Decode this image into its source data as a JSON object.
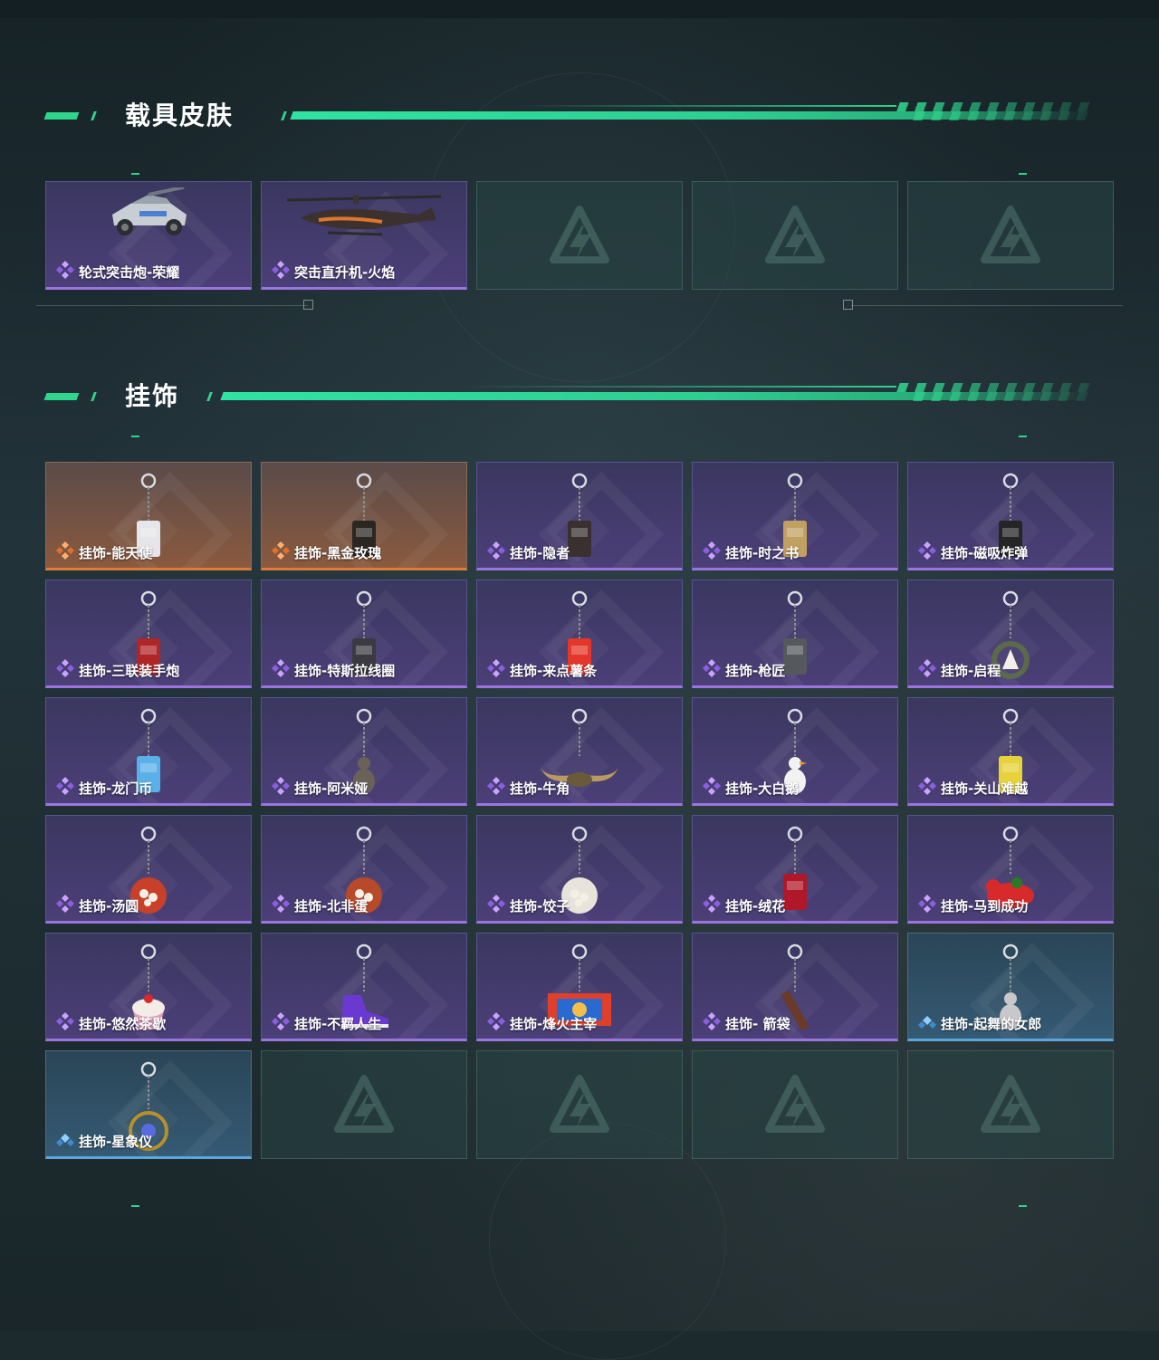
{
  "colors": {
    "accent": "#2fd48d",
    "purple_rarity": "#9b74e0",
    "orange_rarity": "#e07a38",
    "blue_rarity": "#5aa6dd"
  },
  "sections": [
    {
      "title": "载具皮肤",
      "items": [
        {
          "label": "轮式突击炮-荣耀",
          "rarity": "purple",
          "icon": "armored-car-icon"
        },
        {
          "label": "突击直升机-火焰",
          "rarity": "purple",
          "icon": "helicopter-icon"
        },
        {
          "label": "",
          "rarity": "empty"
        },
        {
          "label": "",
          "rarity": "empty"
        },
        {
          "label": "",
          "rarity": "empty"
        }
      ]
    },
    {
      "title": "挂饰",
      "items": [
        {
          "label": "挂饰-能天使",
          "rarity": "orange",
          "icon": "charm-card-icon"
        },
        {
          "label": "挂饰-黑金玫瑰",
          "rarity": "orange",
          "icon": "charm-rose-icon"
        },
        {
          "label": "挂饰-隐者",
          "rarity": "purple",
          "icon": "charm-tarot-icon"
        },
        {
          "label": "挂饰-时之书",
          "rarity": "purple",
          "icon": "charm-book-icon"
        },
        {
          "label": "挂饰-磁吸炸弹",
          "rarity": "purple",
          "icon": "charm-bomb-icon"
        },
        {
          "label": "挂饰-三联装手炮",
          "rarity": "purple",
          "icon": "charm-launcher-icon"
        },
        {
          "label": "挂饰-特斯拉线圈",
          "rarity": "purple",
          "icon": "charm-coil-icon"
        },
        {
          "label": "挂饰-来点薯条",
          "rarity": "purple",
          "icon": "charm-fries-icon"
        },
        {
          "label": "挂饰-枪匠",
          "rarity": "purple",
          "icon": "charm-gunsmith-icon"
        },
        {
          "label": "挂饰-启程",
          "rarity": "purple",
          "icon": "charm-wreath-icon"
        },
        {
          "label": "挂饰-龙门币",
          "rarity": "purple",
          "icon": "charm-coin-icon"
        },
        {
          "label": "挂饰-阿米娅",
          "rarity": "purple",
          "icon": "charm-bunny-icon"
        },
        {
          "label": "挂饰-牛角",
          "rarity": "purple",
          "icon": "charm-horns-icon"
        },
        {
          "label": "挂饰-大白鹅",
          "rarity": "purple",
          "icon": "charm-goose-icon"
        },
        {
          "label": "挂饰-关山难越",
          "rarity": "purple",
          "icon": "charm-scroll-icon"
        },
        {
          "label": "挂饰-汤圆",
          "rarity": "purple",
          "icon": "charm-tangyuan-icon"
        },
        {
          "label": "挂饰-北非蛋",
          "rarity": "purple",
          "icon": "charm-shakshuka-icon"
        },
        {
          "label": "挂饰-饺子",
          "rarity": "purple",
          "icon": "charm-dumpling-icon"
        },
        {
          "label": "挂饰-绒花",
          "rarity": "purple",
          "icon": "charm-flower-icon"
        },
        {
          "label": "挂饰-马到成功",
          "rarity": "purple",
          "icon": "charm-horse-icon"
        },
        {
          "label": "挂饰-悠然茶歇",
          "rarity": "purple",
          "icon": "charm-cupcake-icon"
        },
        {
          "label": "挂饰-不羁人生",
          "rarity": "purple",
          "icon": "charm-sneaker-icon"
        },
        {
          "label": "挂饰-烽火主宰",
          "rarity": "purple",
          "icon": "charm-banner-icon"
        },
        {
          "label": "挂饰- 箭袋",
          "rarity": "purple",
          "icon": "charm-quiver-icon"
        },
        {
          "label": "挂饰-起舞的女郎",
          "rarity": "blue",
          "icon": "charm-dancer-icon"
        },
        {
          "label": "挂饰-星象仪",
          "rarity": "blue",
          "icon": "charm-astrolabe-icon"
        },
        {
          "label": "",
          "rarity": "empty"
        },
        {
          "label": "",
          "rarity": "empty"
        },
        {
          "label": "",
          "rarity": "empty"
        },
        {
          "label": "",
          "rarity": "empty"
        }
      ]
    }
  ]
}
